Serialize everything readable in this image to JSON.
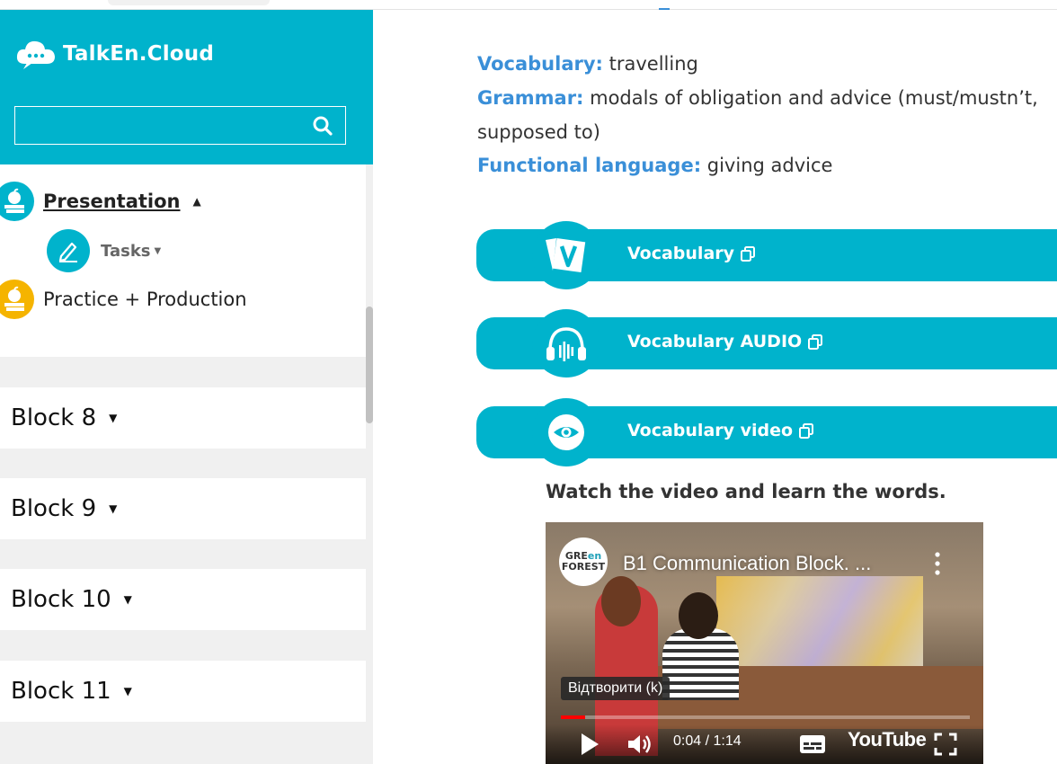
{
  "sidebar": {
    "logo_text": "TalkEn.Cloud",
    "search_placeholder": "",
    "menu": {
      "presentation": "Presentation",
      "tasks": "Tasks",
      "practice": "Practice + Production"
    },
    "blocks": [
      "Block 8",
      "Block 9",
      "Block 10",
      "Block 11"
    ]
  },
  "main": {
    "info": [
      {
        "key": "Vocabulary:",
        "value": " travelling"
      },
      {
        "key": "Grammar:",
        "value": " modals of obligation and advice (must/mustn’t,"
      },
      {
        "key": "",
        "value": "supposed to)"
      },
      {
        "key": "Functional language:",
        "value": " giving advice"
      }
    ],
    "bars": [
      {
        "label": "Vocabulary",
        "icon": "vocabulary-v-icon"
      },
      {
        "label": "Vocabulary AUDIO",
        "icon": "headphones-icon"
      },
      {
        "label": "Vocabulary video",
        "icon": "eye-icon"
      }
    ],
    "instruction": "Watch the video and learn the words.",
    "video": {
      "channel_line1": "GRE",
      "channel_en": "en",
      "channel_line2": "FOREST",
      "title": "B1 Communication Block. ...",
      "tooltip": "Відтворити (k)",
      "time": "0:04 / 1:14",
      "brand": "YouTube",
      "progress": 0.06
    }
  },
  "colors": {
    "accent": "#00b3cc",
    "key_blue": "#3a8fd8",
    "yellow_icon": "#f5b400"
  }
}
